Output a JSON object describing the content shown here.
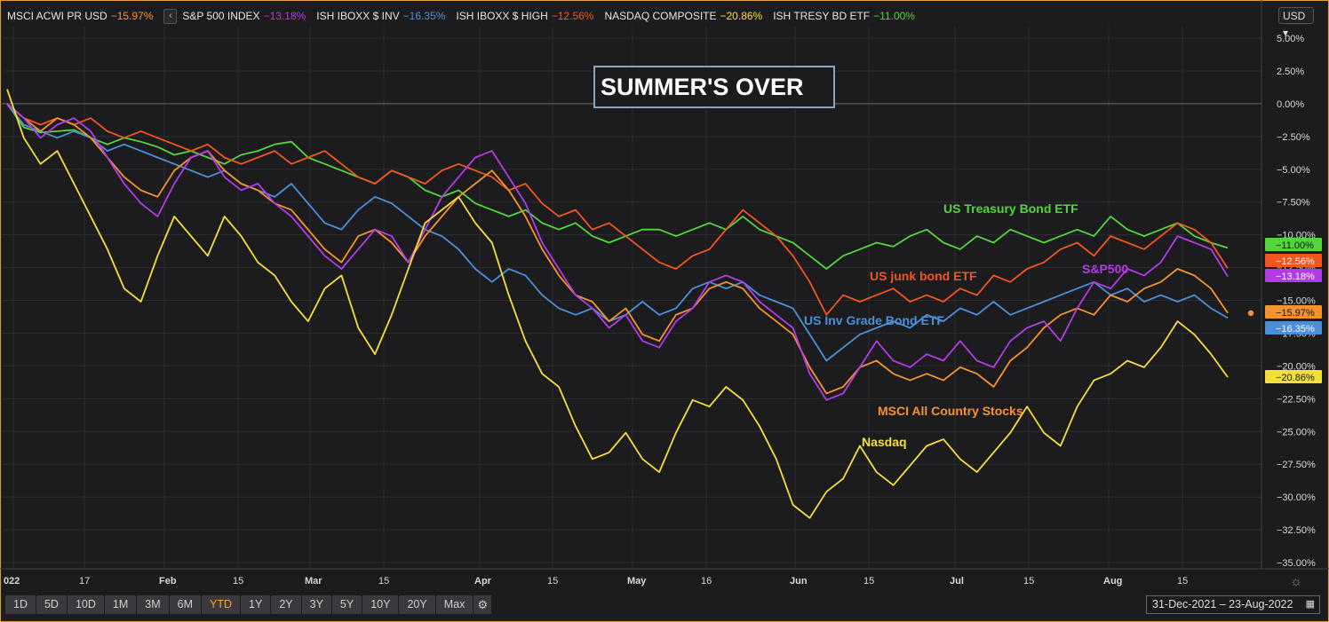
{
  "legend": [
    {
      "name": "MSCI ACWI PR USD",
      "change": "−15.97%",
      "color": "#f7932f"
    },
    {
      "name": "S&P 500 INDEX",
      "change": "−13.18%",
      "color": "#b23be8"
    },
    {
      "name": "ISH IBOXX $ INV",
      "change": "−16.35%",
      "color": "#4a90d9"
    },
    {
      "name": "ISH IBOXX $ HIGH",
      "change": "−12.56%",
      "color": "#f2551e"
    },
    {
      "name": "NASDAQ COMPOSITE",
      "change": "−20.86%",
      "color": "#f5e03a"
    },
    {
      "name": "ISH TRESY BD ETF",
      "change": "−11.00%",
      "color": "#52d63c"
    }
  ],
  "legend_toggle": "‹",
  "currency": "USD ▾",
  "ranges": [
    "1D",
    "5D",
    "10D",
    "1M",
    "3M",
    "6M",
    "YTD",
    "1Y",
    "2Y",
    "3Y",
    "5Y",
    "10Y",
    "20Y",
    "Max"
  ],
  "active_range": "YTD",
  "date_range": "31-Dec-2021 – 23-Aug-2022",
  "chart_data": {
    "type": "line",
    "title": "SUMMER'S OVER",
    "ylim": [
      -35,
      5
    ],
    "y_ticks": [
      "5.00%",
      "2.50%",
      "0.00%",
      "−2.50%",
      "−5.00%",
      "−7.50%",
      "−10.00%",
      "−12.50%",
      "−15.00%",
      "−17.50%",
      "−20.00%",
      "−22.50%",
      "−25.00%",
      "−27.50%",
      "−30.00%",
      "−32.50%",
      "−35.00%"
    ],
    "x_ticks": [
      "022",
      "17",
      "Feb",
      "15",
      "Mar",
      "15",
      "Apr",
      "15",
      "May",
      "16",
      "Jun",
      "15",
      "Jul",
      "15",
      "Aug",
      "15"
    ],
    "grid": true,
    "series": [
      {
        "name": "US Treasury Bond ETF",
        "color": "#52d63c",
        "last": "−11.00%",
        "values": [
          0,
          -1.8,
          -2.2,
          -2.1,
          -2.0,
          -2.6,
          -3.1,
          -2.6,
          -2.9,
          -3.3,
          -3.9,
          -3.6,
          -4.1,
          -4.6,
          -3.9,
          -3.6,
          -3.1,
          -2.9,
          -4.1,
          -4.6,
          -5.1,
          -5.6,
          -6.1,
          -5.1,
          -5.6,
          -6.6,
          -7.1,
          -6.6,
          -7.6,
          -8.1,
          -8.6,
          -8.1,
          -9.1,
          -9.6,
          -9.1,
          -10.1,
          -10.6,
          -10.1,
          -9.6,
          -9.6,
          -10.1,
          -9.6,
          -9.1,
          -9.6,
          -8.6,
          -9.6,
          -10.1,
          -10.6,
          -11.6,
          -12.6,
          -11.6,
          -11.1,
          -10.6,
          -10.9,
          -10.1,
          -9.6,
          -10.6,
          -11.1,
          -10.1,
          -10.6,
          -9.6,
          -10.1,
          -10.6,
          -10.1,
          -9.6,
          -10.1,
          -8.6,
          -9.6,
          -10.1,
          -9.6,
          -9.1,
          -10.1,
          -10.6,
          -11.0
        ]
      },
      {
        "name": "US junk bond ETF",
        "color": "#f2551e",
        "last": "−12.56%",
        "values": [
          0,
          -1.1,
          -1.6,
          -1.1,
          -1.6,
          -1.1,
          -2.1,
          -2.6,
          -2.1,
          -2.6,
          -3.1,
          -3.6,
          -3.1,
          -4.1,
          -4.6,
          -4.1,
          -3.6,
          -4.6,
          -4.1,
          -3.6,
          -4.6,
          -5.6,
          -6.1,
          -5.1,
          -5.6,
          -6.1,
          -5.1,
          -4.6,
          -5.1,
          -5.6,
          -6.6,
          -6.1,
          -7.6,
          -8.6,
          -8.1,
          -9.6,
          -9.1,
          -10.1,
          -11.1,
          -12.1,
          -12.6,
          -11.6,
          -11.1,
          -9.6,
          -8.1,
          -9.1,
          -10.1,
          -11.6,
          -13.6,
          -16.1,
          -14.6,
          -15.1,
          -14.6,
          -14.1,
          -15.1,
          -14.6,
          -15.1,
          -14.1,
          -14.6,
          -13.1,
          -13.6,
          -12.6,
          -12.1,
          -11.1,
          -10.6,
          -11.6,
          -10.1,
          -10.6,
          -11.1,
          -10.1,
          -9.1,
          -9.6,
          -10.6,
          -12.56
        ]
      },
      {
        "name": "US Inv Grade Bond ETF",
        "color": "#4a90d9",
        "last": "−16.35%",
        "values": [
          0,
          -1.6,
          -2.1,
          -2.6,
          -2.1,
          -2.6,
          -3.6,
          -3.1,
          -3.6,
          -4.1,
          -4.6,
          -5.1,
          -5.6,
          -5.1,
          -6.1,
          -6.6,
          -7.1,
          -6.1,
          -7.6,
          -9.1,
          -9.6,
          -8.1,
          -7.1,
          -7.6,
          -8.6,
          -9.6,
          -10.1,
          -11.1,
          -12.6,
          -13.6,
          -12.6,
          -13.1,
          -14.6,
          -15.6,
          -16.1,
          -15.6,
          -16.6,
          -16.1,
          -15.1,
          -16.1,
          -15.6,
          -14.1,
          -13.6,
          -14.1,
          -13.6,
          -14.6,
          -15.1,
          -15.6,
          -17.6,
          -19.6,
          -18.6,
          -17.6,
          -17.1,
          -16.6,
          -17.1,
          -16.1,
          -16.6,
          -15.6,
          -16.1,
          -15.1,
          -16.1,
          -15.6,
          -15.1,
          -14.6,
          -14.1,
          -13.6,
          -14.6,
          -14.1,
          -15.1,
          -14.6,
          -15.1,
          -14.6,
          -15.6,
          -16.35
        ]
      },
      {
        "name": "MSCI All Country Stocks",
        "color": "#f7932f",
        "last": "−15.97%",
        "values": [
          0,
          -1.1,
          -2.1,
          -1.1,
          -1.6,
          -2.6,
          -4.1,
          -5.6,
          -6.6,
          -7.1,
          -5.1,
          -4.1,
          -3.6,
          -5.1,
          -6.1,
          -6.6,
          -7.6,
          -8.1,
          -9.6,
          -11.1,
          -12.1,
          -10.1,
          -9.6,
          -10.6,
          -12.1,
          -10.1,
          -8.6,
          -7.1,
          -6.1,
          -5.1,
          -6.6,
          -8.6,
          -11.1,
          -13.1,
          -14.6,
          -15.1,
          -16.6,
          -15.6,
          -17.6,
          -18.1,
          -16.1,
          -15.6,
          -14.1,
          -13.6,
          -14.1,
          -15.6,
          -16.6,
          -17.6,
          -20.1,
          -22.1,
          -21.6,
          -20.1,
          -19.6,
          -20.6,
          -21.1,
          -20.6,
          -21.1,
          -20.1,
          -20.6,
          -21.6,
          -19.6,
          -18.6,
          -17.1,
          -16.1,
          -15.6,
          -16.1,
          -14.6,
          -15.1,
          -14.1,
          -13.6,
          -12.6,
          -13.1,
          -14.1,
          -15.97
        ]
      },
      {
        "name": "S&P500",
        "color": "#b23be8",
        "last": "−13.18%",
        "values": [
          0,
          -1.1,
          -2.6,
          -1.6,
          -1.1,
          -2.1,
          -4.1,
          -6.1,
          -7.6,
          -8.6,
          -6.1,
          -4.1,
          -3.6,
          -5.6,
          -6.6,
          -6.1,
          -7.6,
          -8.6,
          -10.1,
          -11.6,
          -12.6,
          -11.1,
          -9.6,
          -10.1,
          -12.1,
          -9.6,
          -7.1,
          -5.6,
          -4.1,
          -3.6,
          -5.6,
          -7.6,
          -10.6,
          -12.6,
          -14.6,
          -15.6,
          -17.1,
          -16.1,
          -18.1,
          -18.6,
          -16.6,
          -15.6,
          -13.6,
          -13.1,
          -13.6,
          -15.1,
          -16.1,
          -17.1,
          -20.6,
          -22.6,
          -22.1,
          -20.1,
          -18.1,
          -19.6,
          -20.1,
          -19.1,
          -19.6,
          -18.1,
          -19.6,
          -20.1,
          -18.1,
          -17.1,
          -16.6,
          -18.1,
          -15.6,
          -13.6,
          -14.1,
          -12.6,
          -13.1,
          -12.1,
          -10.1,
          -10.6,
          -11.1,
          -13.18
        ]
      },
      {
        "name": "Nasdaq",
        "color": "#f5e03a",
        "last": "−20.86%",
        "values": [
          1.1,
          -2.6,
          -4.6,
          -3.6,
          -6.1,
          -8.6,
          -11.1,
          -14.1,
          -15.1,
          -11.6,
          -8.6,
          -10.1,
          -11.6,
          -8.6,
          -10.1,
          -12.1,
          -13.1,
          -15.1,
          -16.6,
          -14.1,
          -13.1,
          -17.1,
          -19.1,
          -16.1,
          -12.6,
          -9.1,
          -8.1,
          -7.1,
          -9.1,
          -10.6,
          -14.6,
          -18.1,
          -20.6,
          -21.6,
          -24.6,
          -27.1,
          -26.6,
          -25.1,
          -27.1,
          -28.1,
          -25.1,
          -22.6,
          -23.1,
          -21.6,
          -22.6,
          -24.6,
          -27.1,
          -30.6,
          -31.6,
          -29.6,
          -28.6,
          -26.1,
          -28.1,
          -29.1,
          -27.6,
          -26.1,
          -25.6,
          -27.1,
          -28.1,
          -26.6,
          -25.1,
          -23.1,
          -25.1,
          -26.1,
          -23.1,
          -21.1,
          -20.6,
          -19.6,
          -20.1,
          -18.6,
          -16.6,
          -17.6,
          -19.1,
          -20.86
        ]
      }
    ]
  }
}
